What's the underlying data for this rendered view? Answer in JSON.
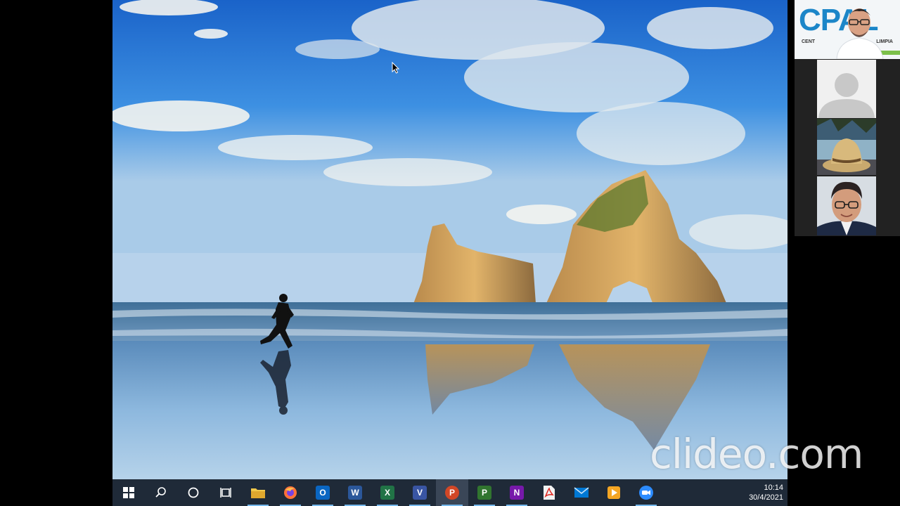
{
  "taskbar": {
    "apps": [
      {
        "name": "file-explorer",
        "letter": "",
        "color": "#f0c040",
        "state": "normal"
      },
      {
        "name": "firefox",
        "letter": "",
        "color": "#ff7139",
        "state": "normal"
      },
      {
        "name": "outlook",
        "letter": "O",
        "color": "#0a66c2",
        "state": "normal"
      },
      {
        "name": "word",
        "letter": "W",
        "color": "#2b579a",
        "state": "normal"
      },
      {
        "name": "excel",
        "letter": "X",
        "color": "#217346",
        "state": "normal"
      },
      {
        "name": "visio",
        "letter": "V",
        "color": "#3955a3",
        "state": "normal"
      },
      {
        "name": "powerpoint",
        "letter": "P",
        "color": "#d24726",
        "state": "active"
      },
      {
        "name": "project",
        "letter": "P",
        "color": "#31752f",
        "state": "normal"
      },
      {
        "name": "onenote",
        "letter": "N",
        "color": "#7719aa",
        "state": "normal"
      },
      {
        "name": "acrobat",
        "letter": "",
        "color": "#e4e4e4",
        "state": "normal"
      },
      {
        "name": "mail",
        "letter": "",
        "color": "#0078d4",
        "state": "normal"
      },
      {
        "name": "media-player",
        "letter": "",
        "color": "#f5a623",
        "state": "normal"
      },
      {
        "name": "zoom",
        "letter": "",
        "color": "#2d8cff",
        "state": "normal"
      }
    ],
    "clock": {
      "time": "10:14",
      "date": "30/4/2021"
    }
  },
  "participants": {
    "host_logo_text": "CPAL",
    "host_logo_sub_left": "CENT",
    "host_logo_sub_right": "LIMPIA"
  },
  "watermark": "clideo.com"
}
